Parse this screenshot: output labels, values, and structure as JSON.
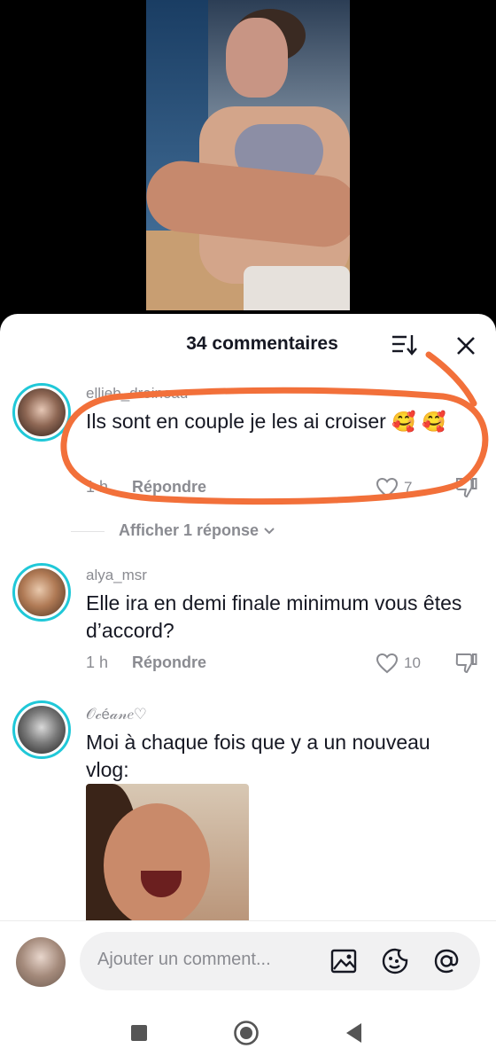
{
  "sheet": {
    "title": "34 commentaires"
  },
  "comments": [
    {
      "username": "ellieb_dreineau",
      "text": "Ils sont en couple je les ai croiser",
      "emoji": "🥰",
      "time": "1 h",
      "reply_label": "Répondre",
      "likes": "7",
      "show_replies": "Afficher 1 réponse"
    },
    {
      "username": "alya_msr",
      "text": "Elle ira en demi finale minimum vous êtes d’accord?",
      "time": "1 h",
      "reply_label": "Répondre",
      "likes": "10"
    },
    {
      "username": "𝒪𝒸é𝒶𝓃𝑒♡",
      "text": "Moi à chaque fois que y a un nouveau vlog:"
    }
  ],
  "input": {
    "placeholder": "Ajouter un comment..."
  },
  "colors": {
    "accent_ring": "#20c8d8",
    "annotation": "#f2703a",
    "muted_text": "#8a8b91"
  },
  "icons": [
    "sort-icon",
    "close-icon",
    "heart-icon",
    "dislike-icon",
    "image-icon",
    "emoji-icon",
    "at-icon",
    "square-nav-icon",
    "home-nav-icon",
    "back-nav-icon"
  ]
}
